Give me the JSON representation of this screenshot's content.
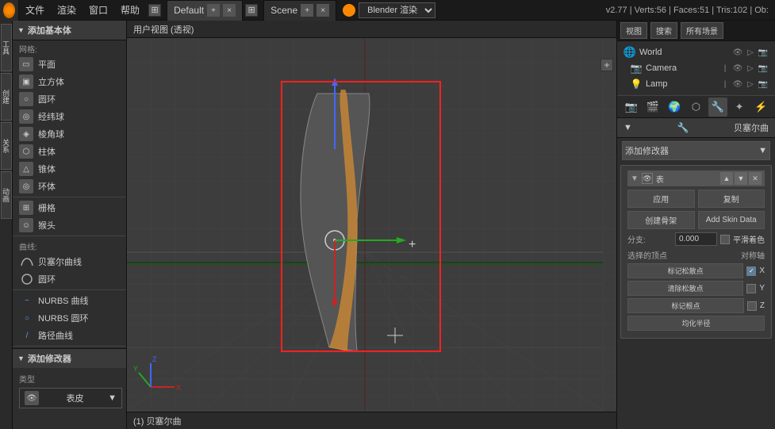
{
  "topbar": {
    "icon": "⊙",
    "menus": [
      "文件",
      "渲染",
      "窗口",
      "帮助"
    ],
    "tabs": [
      {
        "label": "Default",
        "active": true
      },
      {
        "label": "Scene",
        "active": false
      }
    ],
    "engine": "Blender 渲染",
    "version": "v2.77 | Verts:56 | Faces:51 | Tris:102 | Ob:"
  },
  "viewport": {
    "header": "用户视图 (透视)",
    "status": "(1) 贝塞尔曲",
    "plus_btn": "+"
  },
  "left_sidebar": {
    "header": "添加基本体",
    "mesh_label": "网格:",
    "mesh_items": [
      {
        "label": "平面",
        "icon": "▭"
      },
      {
        "label": "立方体",
        "icon": "▣"
      },
      {
        "label": "圆环",
        "icon": "○"
      },
      {
        "label": "经纬球",
        "icon": "◎"
      },
      {
        "label": "棱角球",
        "icon": "◈"
      },
      {
        "label": "柱体",
        "icon": "⬡"
      },
      {
        "label": "锥体",
        "icon": "△"
      },
      {
        "label": "环体",
        "icon": "◎"
      }
    ],
    "grid_label": "栅格",
    "monkey_label": "猴头",
    "curve_label": "曲线:",
    "curve_items": [
      {
        "label": "贝塞尔曲线",
        "icon": "~"
      },
      {
        "label": "圆环",
        "icon": "○"
      }
    ],
    "nurbs_items": [
      {
        "label": "NURBS 曲线",
        "icon": "~"
      },
      {
        "label": "NURBS 圆环",
        "icon": "○"
      },
      {
        "label": "路径曲线",
        "icon": "/"
      }
    ],
    "add_modifier": "添加修改器",
    "type_label": "类型",
    "type_value": "表皮"
  },
  "right_panel": {
    "tabs": [
      "视图",
      "搜索",
      "所有场景"
    ],
    "scene_items": [
      {
        "label": "World",
        "icon": "world"
      },
      {
        "label": "Camera",
        "icon": "camera"
      },
      {
        "label": "Lamp",
        "icon": "lamp"
      }
    ],
    "prop_title": "贝塞尔曲",
    "add_modifier_btn": "添加修改器",
    "modifier": {
      "title": "表",
      "apply_btn": "应用",
      "copy_btn": "复制",
      "create_armature_btn": "创建骨架",
      "add_skin_data_btn": "Add Skin Data",
      "branch_label": "分支:",
      "branch_value": "0.000",
      "smooth_shading": "平滑着色",
      "selected_vertex_label": "选择的顶点",
      "mirror_axis_label": "对称轴",
      "mark_loose_label": "标记松散点",
      "x_checkbox": "X",
      "clear_loose_label": "清除松散点",
      "y_checkbox": "Y",
      "mark_root_label": "标记根点",
      "z_checkbox": "Z",
      "equalize_radii_label": "均化半径"
    }
  }
}
